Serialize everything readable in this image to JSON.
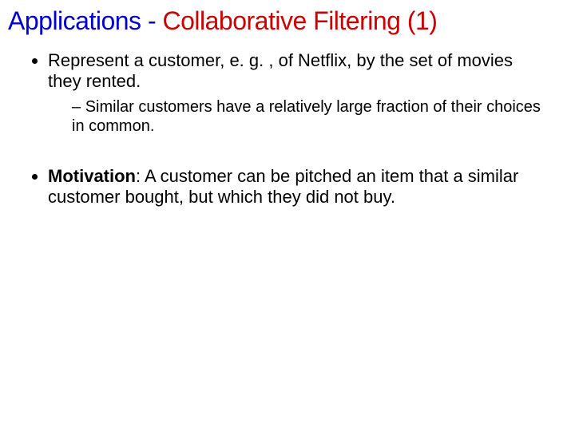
{
  "title": {
    "part1": "Applications ",
    "sep": "-",
    "part2": " Collaborative Filtering (1)"
  },
  "bullets": {
    "b1": "Represent a customer, e. g. , of Netflix, by the set of movies they rented.",
    "b1_sub1": "Similar customers have a relatively large fraction of their choices in common.",
    "b2_label": "Motivation",
    "b2_rest": ": A customer can be pitched an item that a similar customer bought, but which they did not buy."
  }
}
